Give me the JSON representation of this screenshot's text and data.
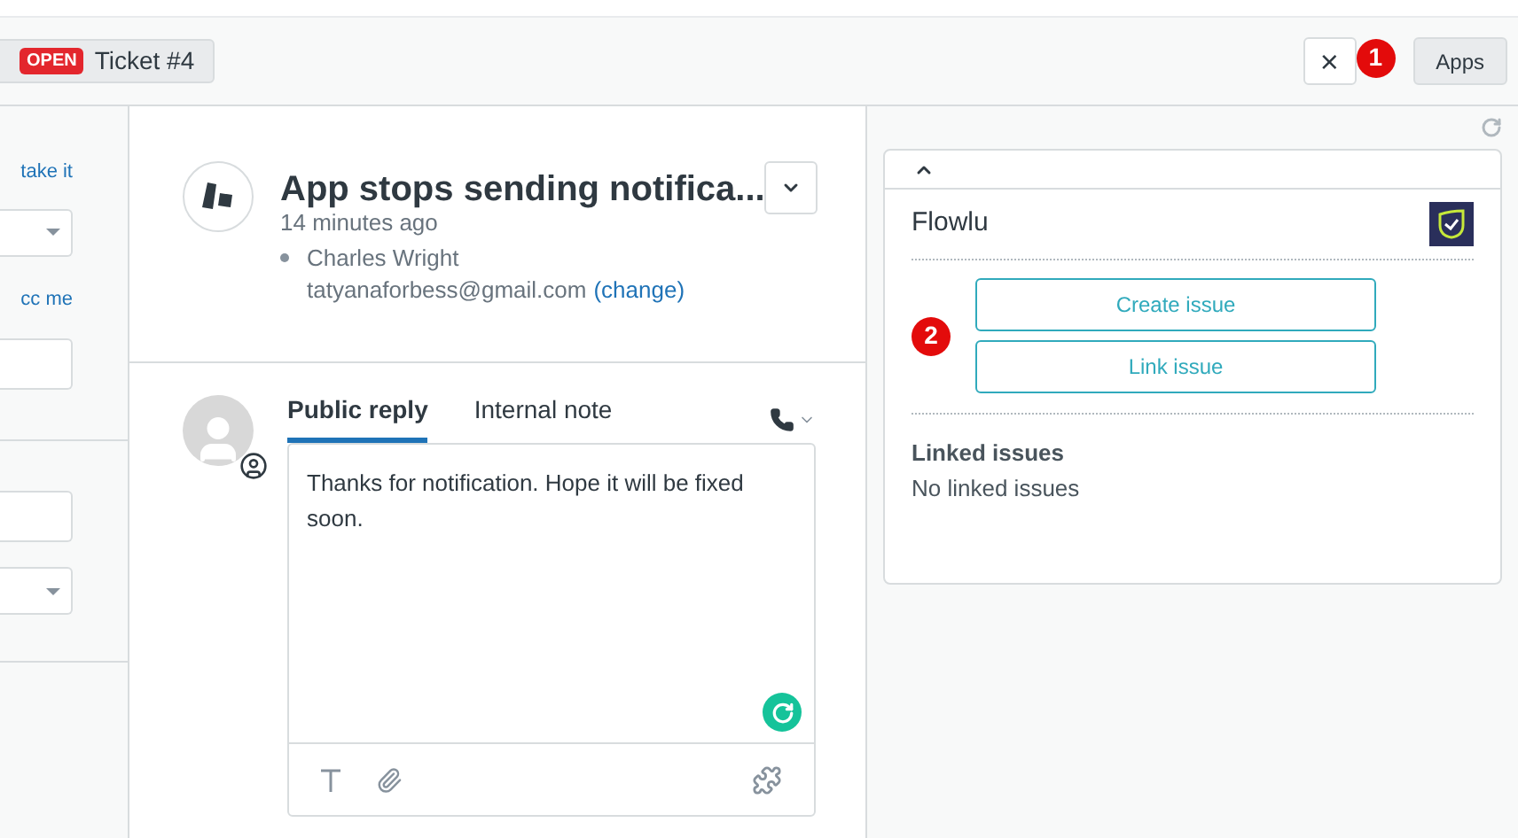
{
  "header": {
    "ticket_tab": {
      "status": "OPEN",
      "label": "Ticket #4"
    },
    "close_button": "×",
    "apps_button": "Apps",
    "marker": "1"
  },
  "left_panel": {
    "items": [
      {
        "kind": "link",
        "text": "take it"
      },
      {
        "kind": "select"
      },
      {
        "kind": "link",
        "text": "cc me"
      },
      {
        "kind": "input"
      },
      {
        "kind": "divider"
      },
      {
        "kind": "input"
      },
      {
        "kind": "select"
      },
      {
        "kind": "divider"
      }
    ]
  },
  "ticket": {
    "title": "App stops sending notifica...",
    "time": "14 minutes ago",
    "requester": "Charles Wright",
    "email": "tatyanaforbess@gmail.com",
    "change_link": "(change)"
  },
  "reply": {
    "tabs": [
      {
        "label": "Public reply",
        "selected": true
      },
      {
        "label": "Internal note",
        "selected": false
      }
    ],
    "value": "Thanks for notification. Hope it will be fixed soon."
  },
  "app": {
    "title": "Flowlu",
    "marker": "2",
    "buttons": [
      "Create issue",
      "Link issue"
    ],
    "linked_title": "Linked issues",
    "linked_empty": "No linked issues"
  }
}
